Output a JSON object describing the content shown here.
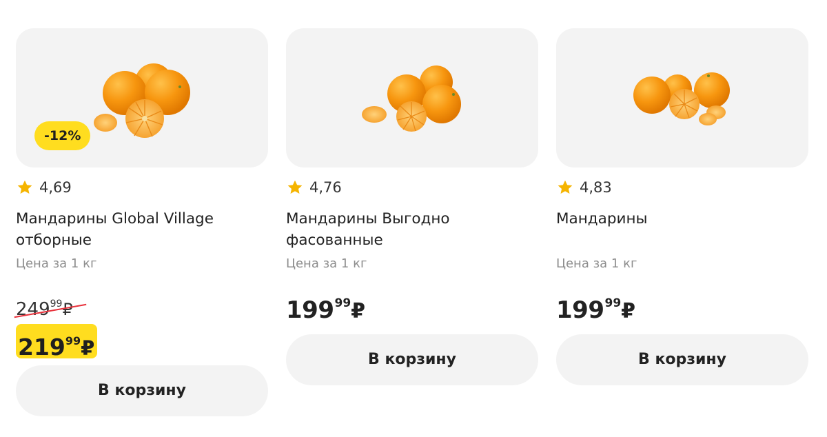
{
  "colors": {
    "accent_yellow": "#ffdd1f",
    "star": "#f5b400",
    "strike": "#e8313b",
    "card_bg": "#f3f3f3",
    "text_muted": "#8d8d8d"
  },
  "products": [
    {
      "image_icon": "tangerines-image",
      "discount_badge": "-12%",
      "rating": "4,69",
      "title": "Мандарины Global Village отборные",
      "unit_label": "Цена за 1 кг",
      "old_price": {
        "main": "249",
        "cents": "99",
        "currency": "₽"
      },
      "price": {
        "main": "219",
        "cents": "99",
        "currency": "₽"
      },
      "cart_button": "В корзину"
    },
    {
      "image_icon": "tangerines-image",
      "rating": "4,76",
      "title": "Мандарины Выгодно фасованные",
      "unit_label": "Цена за 1 кг",
      "price": {
        "main": "199",
        "cents": "99",
        "currency": "₽"
      },
      "cart_button": "В корзину"
    },
    {
      "image_icon": "tangerines-image",
      "rating": "4,83",
      "title": "Мандарины",
      "unit_label": "Цена за 1 кг",
      "price": {
        "main": "199",
        "cents": "99",
        "currency": "₽"
      },
      "cart_button": "В корзину"
    }
  ]
}
